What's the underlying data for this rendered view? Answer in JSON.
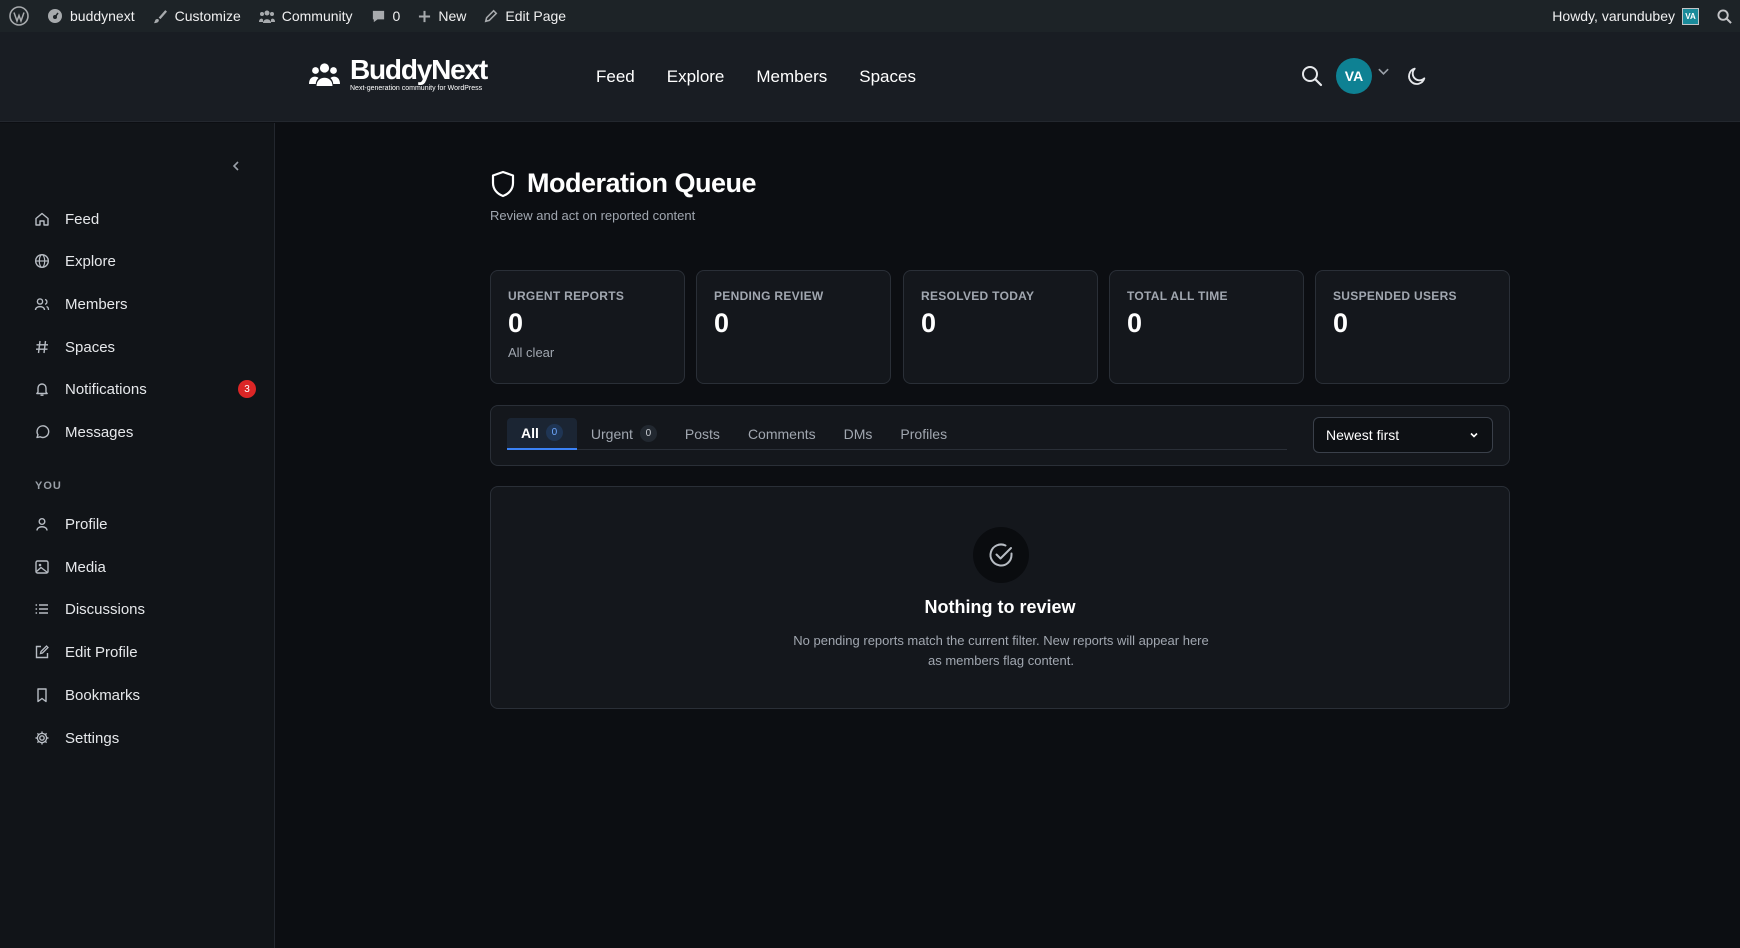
{
  "admin_bar": {
    "site_name": "buddynext",
    "customize": "Customize",
    "community": "Community",
    "comments_count": "0",
    "new": "New",
    "edit_page": "Edit Page",
    "greeting": "Howdy, varundubey",
    "avatar_initials": "VA"
  },
  "header": {
    "logo_title": "BuddyNext",
    "logo_subtitle": "Next-generation community for WordPress",
    "nav": [
      "Feed",
      "Explore",
      "Members",
      "Spaces"
    ],
    "avatar_initials": "VA"
  },
  "sidebar": {
    "main_items": [
      {
        "label": "Feed",
        "icon": "home-icon"
      },
      {
        "label": "Explore",
        "icon": "globe-icon"
      },
      {
        "label": "Members",
        "icon": "users-icon"
      },
      {
        "label": "Spaces",
        "icon": "hash-icon"
      },
      {
        "label": "Notifications",
        "icon": "bell-icon",
        "badge": "3"
      },
      {
        "label": "Messages",
        "icon": "chat-icon"
      }
    ],
    "section_label": "YOU",
    "you_items": [
      {
        "label": "Profile",
        "icon": "user-icon"
      },
      {
        "label": "Media",
        "icon": "image-icon"
      },
      {
        "label": "Discussions",
        "icon": "list-icon"
      },
      {
        "label": "Edit Profile",
        "icon": "edit-icon"
      },
      {
        "label": "Bookmarks",
        "icon": "bookmark-icon"
      },
      {
        "label": "Settings",
        "icon": "gear-icon"
      }
    ]
  },
  "page": {
    "title": "Moderation Queue",
    "subtitle": "Review and act on reported content"
  },
  "stats": [
    {
      "label": "URGENT REPORTS",
      "value": "0",
      "note": "All clear"
    },
    {
      "label": "PENDING REVIEW",
      "value": "0"
    },
    {
      "label": "RESOLVED TODAY",
      "value": "0"
    },
    {
      "label": "TOTAL ALL TIME",
      "value": "0"
    },
    {
      "label": "SUSPENDED USERS",
      "value": "0"
    }
  ],
  "tabs": [
    {
      "label": "All",
      "count": "0",
      "active": true
    },
    {
      "label": "Urgent",
      "count": "0"
    },
    {
      "label": "Posts"
    },
    {
      "label": "Comments"
    },
    {
      "label": "DMs"
    },
    {
      "label": "Profiles"
    }
  ],
  "sort": {
    "selected": "Newest first"
  },
  "empty_state": {
    "title": "Nothing to review",
    "text": "No pending reports match the current filter. New reports will appear here as members flag content."
  },
  "colors": {
    "accent": "#3b82f6",
    "avatar": "#0e8193",
    "badge": "#dc2626"
  }
}
